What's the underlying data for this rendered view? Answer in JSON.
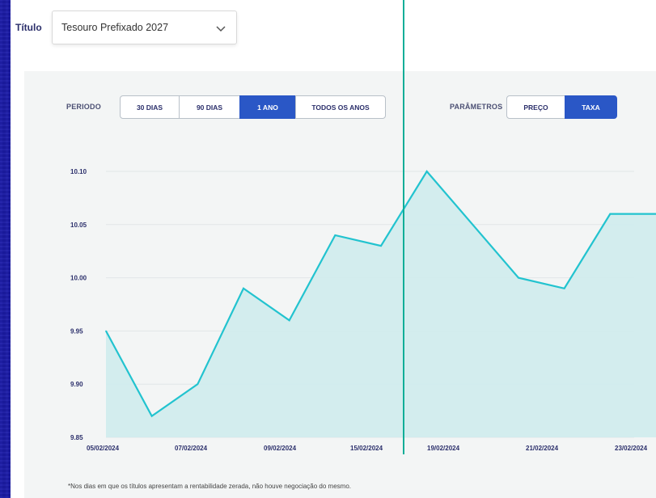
{
  "header": {
    "title_label": "Título",
    "selected_title": "Tesouro Prefixado 2027"
  },
  "controls": {
    "period_label": "PERIODO",
    "period_options": [
      "30 DIAS",
      "90 DIAS",
      "1 ANO",
      "TODOS OS ANOS"
    ],
    "period_selected": "1 ANO",
    "params_label": "PARÂMETROS",
    "param_options": [
      "PREÇO",
      "TAXA"
    ],
    "param_selected": "TAXA"
  },
  "footnote": "*Nos dias em que os títulos apresentam a rentabilidade zerada, não houve negociação do mesmo.",
  "colors": {
    "accent": "#2a57c6",
    "line": "#22c3cf",
    "fill": "#cfeced",
    "cursor": "#0fae98"
  },
  "chart_data": {
    "type": "area",
    "x_ticks": [
      "05/02/2024",
      "07/02/2024",
      "09/02/2024",
      "15/02/2024",
      "19/02/2024",
      "21/02/2024",
      "23/02/2024"
    ],
    "y_ticks": [
      "9.85",
      "9.90",
      "9.95",
      "10.00",
      "10.05",
      "10.10"
    ],
    "ylim": [
      9.85,
      10.1
    ],
    "series": [
      {
        "values": [
          9.95,
          9.87,
          9.9,
          9.99,
          9.96,
          10.04,
          10.03,
          10.1,
          10.05,
          10.0,
          9.99,
          10.06,
          10.06
        ]
      }
    ],
    "grid": true
  }
}
